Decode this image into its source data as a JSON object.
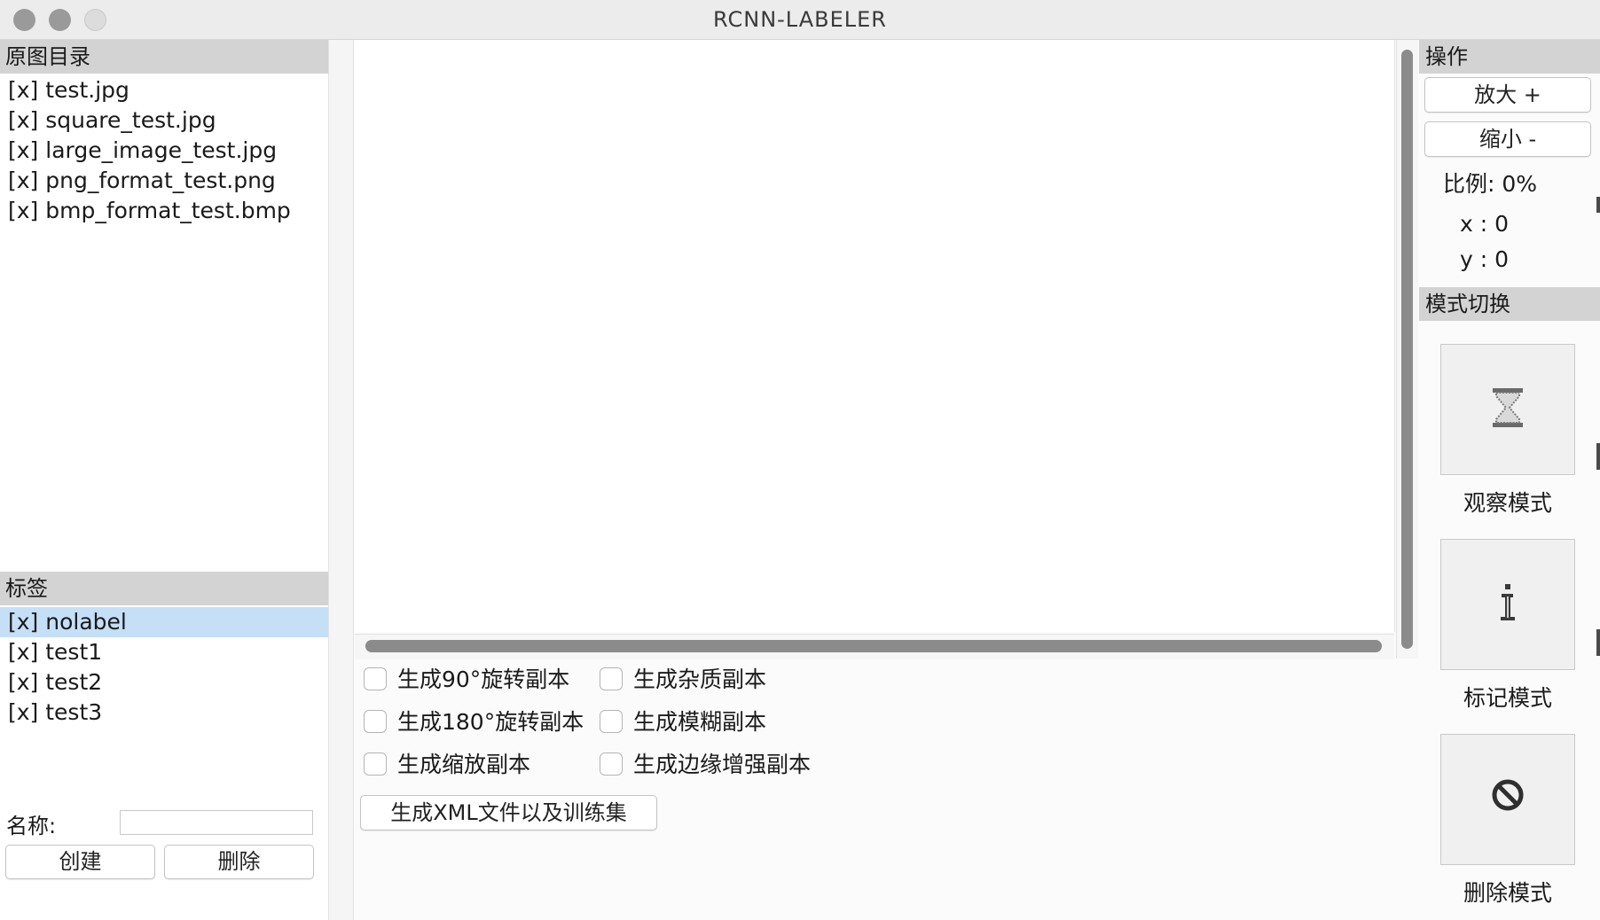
{
  "window": {
    "title": "RCNN-LABELER"
  },
  "left_panel": {
    "images_header": "原图目录",
    "images": [
      "[x] test.jpg",
      "[x] square_test.jpg",
      "[x] large_image_test.jpg",
      "[x] png_format_test.png",
      "[x] bmp_format_test.bmp"
    ],
    "labels_header": "标签",
    "labels": [
      "[x] nolabel",
      "[x] test1",
      "[x] test2",
      "[x] test3"
    ],
    "selected_label": "[x] nolabel",
    "name_label": "名称:",
    "name_value": "",
    "create_button": "创建",
    "delete_button": "删除"
  },
  "options": {
    "rotate90": "生成90°旋转副本",
    "rotate180": "生成180°旋转副本",
    "scale": "生成缩放副本",
    "noise": "生成杂质副本",
    "blur": "生成模糊副本",
    "edge": "生成边缘增强副本",
    "generate_button": "生成XML文件以及训练集"
  },
  "right_panel": {
    "operations_header": "操作",
    "zoom_in": "放大 +",
    "zoom_out": "缩小 -",
    "ratio": "比例: 0%",
    "x": "x : 0",
    "y": "y : 0",
    "mode_header": "模式切换",
    "modes": [
      {
        "label": "观察模式",
        "icon": "hourglass-icon"
      },
      {
        "label": "标记模式",
        "icon": "text-cursor-icon"
      },
      {
        "label": "删除模式",
        "icon": "forbidden-icon"
      }
    ]
  }
}
